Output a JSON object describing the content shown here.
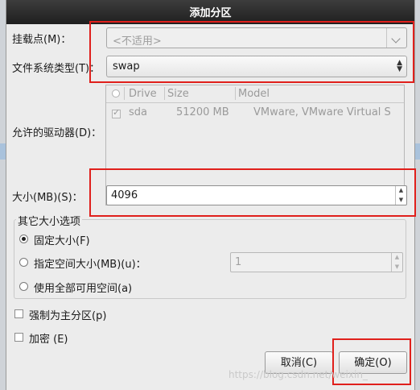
{
  "dialog": {
    "title": "添加分区",
    "mount_label": "挂载点(M)：",
    "mount_value": "<不适用>",
    "fstype_label": "文件系统类型(T)：",
    "fstype_value": "swap",
    "drives_label": "允许的驱动器(D)：",
    "drives_table": {
      "headers": [
        "Drive",
        "Size",
        "Model"
      ],
      "rows": [
        {
          "checked": true,
          "drive": "sda",
          "size": "51200 MB",
          "model": "VMware, VMware Virtual S"
        }
      ]
    },
    "size_label": "大小(MB)(S)：",
    "size_value": "4096",
    "other_size_group": "其它大小选项",
    "opt_fixed": "固定大小(F)",
    "opt_upto": "指定空间大小(MB)(u)：",
    "opt_upto_value": "1",
    "opt_fill": "使用全部可用空间(a)",
    "force_primary": "强制为主分区(p)",
    "encrypt": "加密 (E)",
    "cancel": "取消(C)",
    "ok": "确定(O)"
  },
  "watermark": "https://blog.csdn.net/weixin_",
  "colors": {
    "highlight": "#e0201c",
    "titlebar": "#2a2a2a"
  }
}
